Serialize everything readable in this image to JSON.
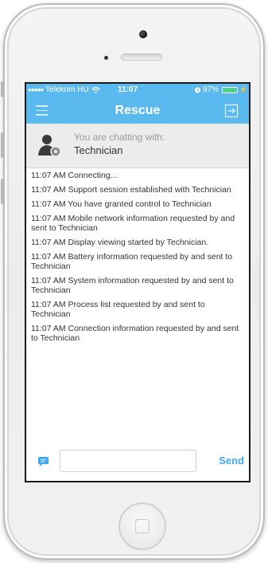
{
  "status_bar": {
    "signal_dots": "●●●●●",
    "carrier": "Telekom HU",
    "wifi_icon": "wifi-icon",
    "time": "11:07",
    "alarm_icon": "alarm-icon",
    "battery_percent": "97%",
    "battery_level": 0.97,
    "battery_color": "#4cd964"
  },
  "navbar": {
    "title": "Rescue",
    "menu_icon": "hamburger-menu-icon",
    "exit_icon": "exit-icon",
    "background": "#5ab9ee"
  },
  "chat_header": {
    "subtitle": "You are chatting with:",
    "name": "Technician",
    "avatar_icon": "technician-avatar-icon"
  },
  "log": [
    "11:07 AM Connecting...",
    "11:07 AM Support session established with Technician",
    "11:07 AM You have granted control to Technician",
    "11:07 AM Mobile network information requested by and sent to Technician",
    "11:07 AM Display viewing started by Technician.",
    "11:07 AM Battery information requested by and sent to Technician",
    "11:07 AM System information requested by and sent to Technician",
    "11:07 AM Process list requested by and sent to Technician",
    "11:07 AM Connection information requested by and sent to Technician"
  ],
  "compose": {
    "chat_icon": "chat-bubble-icon",
    "input_value": "",
    "input_placeholder": "",
    "send_label": "Send",
    "accent": "#3fa9f5"
  }
}
